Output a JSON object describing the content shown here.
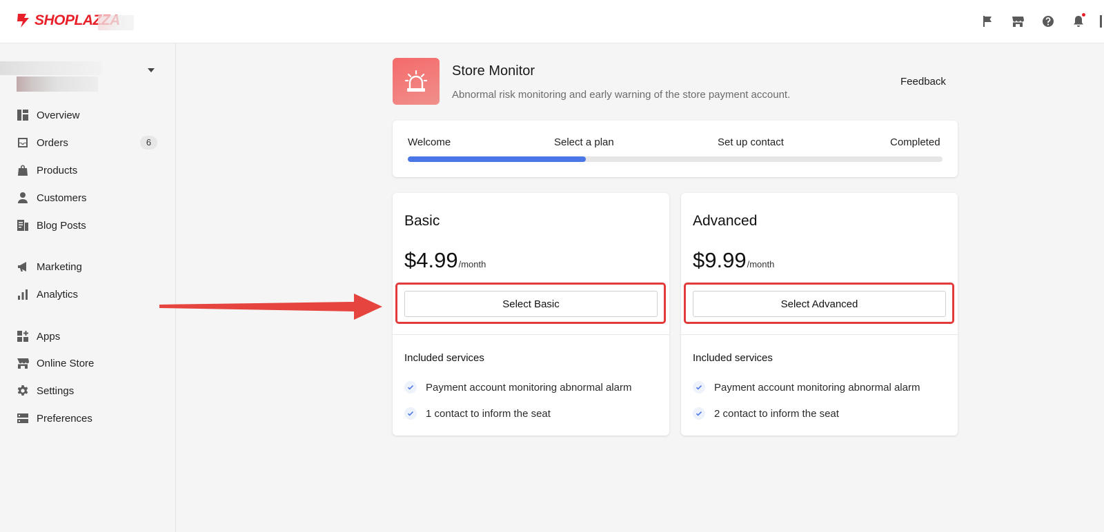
{
  "brand": {
    "name": "SHOPLAZZA",
    "color": "#e8202a"
  },
  "topbar": {
    "icons": [
      "flag-icon",
      "store-icon",
      "help-icon",
      "bell-icon"
    ]
  },
  "sidebar": {
    "items": [
      {
        "label": "Overview",
        "icon": "overview-icon"
      },
      {
        "label": "Orders",
        "icon": "orders-icon",
        "badge": "6"
      },
      {
        "label": "Products",
        "icon": "products-icon"
      },
      {
        "label": "Customers",
        "icon": "customers-icon"
      },
      {
        "label": "Blog Posts",
        "icon": "blog-icon"
      },
      {
        "label": "Marketing",
        "icon": "marketing-icon"
      },
      {
        "label": "Analytics",
        "icon": "analytics-icon"
      },
      {
        "label": "Apps",
        "icon": "apps-icon"
      },
      {
        "label": "Online Store",
        "icon": "online-store-icon"
      },
      {
        "label": "Settings",
        "icon": "settings-icon"
      },
      {
        "label": "Preferences",
        "icon": "preferences-icon"
      }
    ]
  },
  "app": {
    "title": "Store Monitor",
    "description": "Abnormal risk monitoring and early warning of the store payment account.",
    "feedback_label": "Feedback",
    "icon": "alarm-icon",
    "icon_color": "#f46a6a"
  },
  "steps": {
    "items": [
      "Welcome",
      "Select a plan",
      "Set up contact",
      "Completed"
    ],
    "current": 2,
    "progress": 0.333,
    "progress_color": "#4a76e8"
  },
  "plans": [
    {
      "name": "Basic",
      "price": "$4.99",
      "period": "/month",
      "button_label": "Select Basic",
      "services_title": "Included services",
      "services": [
        "Payment account monitoring abnormal alarm",
        "1 contact to inform the seat"
      ]
    },
    {
      "name": "Advanced",
      "price": "$9.99",
      "period": "/month",
      "button_label": "Select Advanced",
      "services_title": "Included services",
      "services": [
        "Payment account monitoring abnormal alarm",
        "2 contact to inform the seat"
      ]
    }
  ],
  "annotation": {
    "color": "#e23b3b"
  }
}
